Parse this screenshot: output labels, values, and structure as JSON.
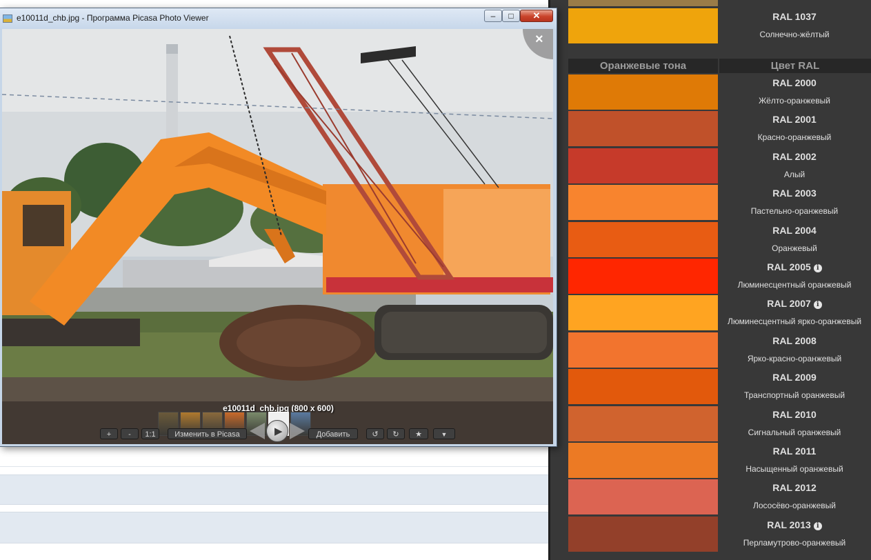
{
  "viewer": {
    "window_title": "e10011d_chb.jpg - Программа Picasa Photo Viewer",
    "caption": "e10011d_chb.jpg (800 x 600)",
    "close_glyph": "×",
    "controls": {
      "zoom_in": "+",
      "zoom_out": "-",
      "actual_size": "1:1",
      "edit": "Изменить в Picasa",
      "add": "Добавить",
      "rotate_left": "↺",
      "rotate_right": "↻",
      "star": "★",
      "more": "▼",
      "play": "▶"
    },
    "thumbnail_count": 7
  },
  "ral": {
    "top_entry": {
      "code": "RAL 1037",
      "name": "Солнечно-жёлтый",
      "color": "#efa40c"
    },
    "top_partial_color": "#9a7c48",
    "header_left": "Оранжевые тона",
    "header_right": "Цвет RAL",
    "items": [
      {
        "code": "RAL 2000",
        "name": "Жёлто-оранжевый",
        "color": "#df7a06",
        "info": false
      },
      {
        "code": "RAL 2001",
        "name": "Красно-оранжевый",
        "color": "#c0512a",
        "info": false
      },
      {
        "code": "RAL 2002",
        "name": "Алый",
        "color": "#c63a2a",
        "info": false
      },
      {
        "code": "RAL 2003",
        "name": "Пастельно-оранжевый",
        "color": "#f8842e",
        "info": false
      },
      {
        "code": "RAL 2004",
        "name": "Оранжевый",
        "color": "#e85c13",
        "info": false
      },
      {
        "code": "RAL 2005",
        "name": "Люминесцентный оранжевый",
        "color": "#ff2600",
        "info": true
      },
      {
        "code": "RAL 2007",
        "name": "Люминесцентный ярко-оранжевый",
        "color": "#ffa421",
        "info": true
      },
      {
        "code": "RAL 2008",
        "name": "Ярко-красно-оранжевый",
        "color": "#f2742e",
        "info": false
      },
      {
        "code": "RAL 2009",
        "name": "Транспортный оранжевый",
        "color": "#e2590c",
        "info": false
      },
      {
        "code": "RAL 2010",
        "name": "Сигнальный оранжевый",
        "color": "#d0632e",
        "info": false
      },
      {
        "code": "RAL 2011",
        "name": "Насыщенный оранжевый",
        "color": "#ec7a24",
        "info": false
      },
      {
        "code": "RAL 2012",
        "name": "Лососёво-оранжевый",
        "color": "#dc6452",
        "info": false
      },
      {
        "code": "RAL 2013",
        "name": "Перламутрово-оранжевый",
        "color": "#93402a",
        "info": true
      }
    ]
  }
}
